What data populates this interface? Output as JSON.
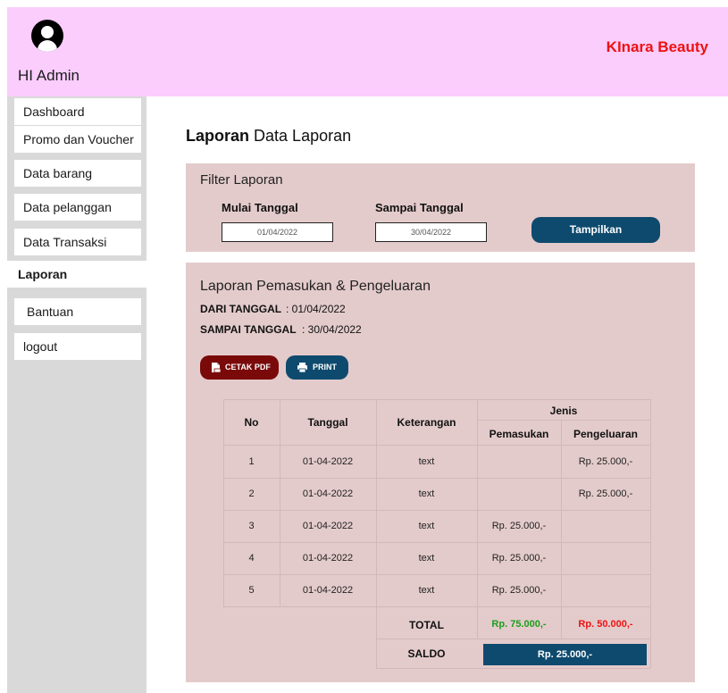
{
  "header": {
    "greeting": "HI Admin",
    "brand": "KInara Beauty",
    "avatar_icon": "user-avatar-icon",
    "background_color": "#facdfc",
    "brand_color": "#ee1111"
  },
  "sidebar": {
    "items": [
      {
        "label": "Dashboard"
      },
      {
        "label": "Promo dan Voucher"
      },
      {
        "label": "Data barang"
      },
      {
        "label": "Data pelanggan"
      },
      {
        "label": "Data Transaksi"
      },
      {
        "label": "Laporan",
        "active": true
      },
      {
        "label": "Bantuan"
      },
      {
        "label": "logout"
      }
    ]
  },
  "page": {
    "title_bold": "Laporan",
    "title_rest": "Data Laporan"
  },
  "filter": {
    "title": "Filter Laporan",
    "start_label": "Mulai Tanggal",
    "start_value": "01/04/2022",
    "end_label": "Sampai Tanggal",
    "end_value": "30/04/2022",
    "button_label": "Tampilkan",
    "button_color": "#0e4a6e"
  },
  "report": {
    "title": "Laporan Pemasukan & Pengeluaran",
    "from_label": "DARI TANGGAL",
    "from_value": ": 01/04/2022",
    "to_label": "SAMPAI TANGGAL",
    "to_value": ": 30/04/2022",
    "pdf_button": "CETAK PDF",
    "pdf_icon": "pdf-file-icon",
    "print_button": "PRINT",
    "print_icon": "printer-icon"
  },
  "table": {
    "headers": {
      "no": "No",
      "tanggal": "Tanggal",
      "keterangan": "Keterangan",
      "jenis": "Jenis",
      "pemasukan": "Pemasukan",
      "pengeluaran": "Pengeluaran"
    },
    "rows": [
      {
        "no": "1",
        "tanggal": "01-04-2022",
        "keterangan": "text",
        "pemasukan": "",
        "pengeluaran": "Rp. 25.000,-"
      },
      {
        "no": "2",
        "tanggal": "01-04-2022",
        "keterangan": "text",
        "pemasukan": "",
        "pengeluaran": "Rp. 25.000,-"
      },
      {
        "no": "3",
        "tanggal": "01-04-2022",
        "keterangan": "text",
        "pemasukan": "Rp. 25.000,-",
        "pengeluaran": ""
      },
      {
        "no": "4",
        "tanggal": "01-04-2022",
        "keterangan": "text",
        "pemasukan": "Rp. 25.000,-",
        "pengeluaran": ""
      },
      {
        "no": "5",
        "tanggal": "01-04-2022",
        "keterangan": "text",
        "pemasukan": "Rp. 25.000,-",
        "pengeluaran": ""
      }
    ],
    "total_label": "TOTAL",
    "total_pemasukan": "Rp. 75.000,-",
    "total_pengeluaran": "Rp. 50.000,-",
    "saldo_label": "SALDO",
    "saldo_value": "Rp. 25.000,-",
    "income_color": "#1a9e1a",
    "expense_color": "#ee1111",
    "saldo_color": "#0e4a6e"
  }
}
